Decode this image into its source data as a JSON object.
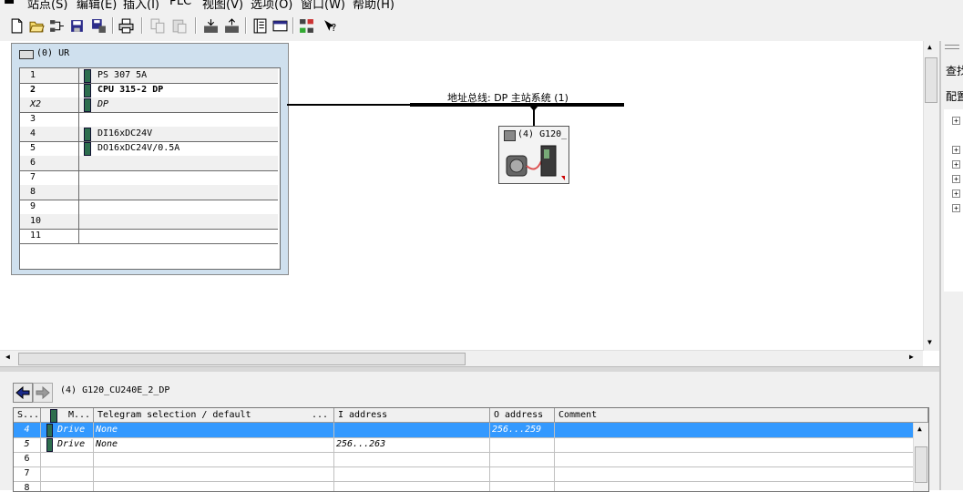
{
  "menu": [
    "站点(S)",
    "编辑(E)",
    "插入(I)",
    "PLC",
    "视图(V)",
    "选项(O)",
    "窗口(W)",
    "帮助(H)"
  ],
  "toolbar_icons": [
    "new-icon",
    "open-icon",
    "network-icon",
    "save-icon",
    "save-compile-icon",
    "print-icon",
    "copy-icon",
    "paste-icon",
    "download-icon",
    "upload-icon",
    "catalog-icon",
    "window-icon",
    "config-icon",
    "help-icon"
  ],
  "rack": {
    "title": "(0) UR",
    "rows": [
      {
        "slot": "1",
        "module": "PS 307 5A",
        "icon": true,
        "bold": false,
        "italic": false
      },
      {
        "slot": "2",
        "module": "CPU 315-2 DP",
        "icon": true,
        "bold": true,
        "italic": false
      },
      {
        "slot": "X2",
        "module": "DP",
        "icon": true,
        "bold": false,
        "italic": true
      },
      {
        "slot": "3",
        "module": "",
        "icon": false,
        "bold": false,
        "italic": false
      },
      {
        "slot": "4",
        "module": "DI16xDC24V",
        "icon": true,
        "bold": false,
        "italic": false
      },
      {
        "slot": "5",
        "module": "DO16xDC24V/0.5A",
        "icon": true,
        "bold": false,
        "italic": false
      },
      {
        "slot": "6",
        "module": "",
        "icon": false,
        "bold": false,
        "italic": false
      },
      {
        "slot": "7",
        "module": "",
        "icon": false,
        "bold": false,
        "italic": false
      },
      {
        "slot": "8",
        "module": "",
        "icon": false,
        "bold": false,
        "italic": false
      },
      {
        "slot": "9",
        "module": "",
        "icon": false,
        "bold": false,
        "italic": false
      },
      {
        "slot": "10",
        "module": "",
        "icon": false,
        "bold": false,
        "italic": false
      },
      {
        "slot": "11",
        "module": "",
        "icon": false,
        "bold": false,
        "italic": false
      }
    ]
  },
  "bus": {
    "label": "地址总线: DP 主站系统 (1)"
  },
  "device": {
    "label": "(4) G120_"
  },
  "right_panel": {
    "text1": "查找",
    "text2": "配置"
  },
  "detail": {
    "title": "(4)    G120_CU240E_2_DP",
    "columns": [
      "S...",
      "M...",
      "Telegram selection / default",
      "...",
      "I address",
      "O address",
      "Comment"
    ],
    "rows": [
      {
        "s": "4",
        "m": "Drive",
        "telegram": "None",
        "i_address": "",
        "o_address": "256...259",
        "comment": "",
        "selected": true
      },
      {
        "s": "5",
        "m": "Drive",
        "telegram": "None",
        "i_address": "256...263",
        "o_address": "",
        "comment": "",
        "selected": false
      },
      {
        "s": "6",
        "m": "",
        "telegram": "",
        "i_address": "",
        "o_address": "",
        "comment": "",
        "selected": false
      },
      {
        "s": "7",
        "m": "",
        "telegram": "",
        "i_address": "",
        "o_address": "",
        "comment": "",
        "selected": false
      },
      {
        "s": "8",
        "m": "",
        "telegram": "",
        "i_address": "",
        "o_address": "",
        "comment": "",
        "selected": false
      }
    ]
  },
  "colors": {
    "selection": "#3399ff",
    "rack_bg": "#cfe0ee"
  }
}
